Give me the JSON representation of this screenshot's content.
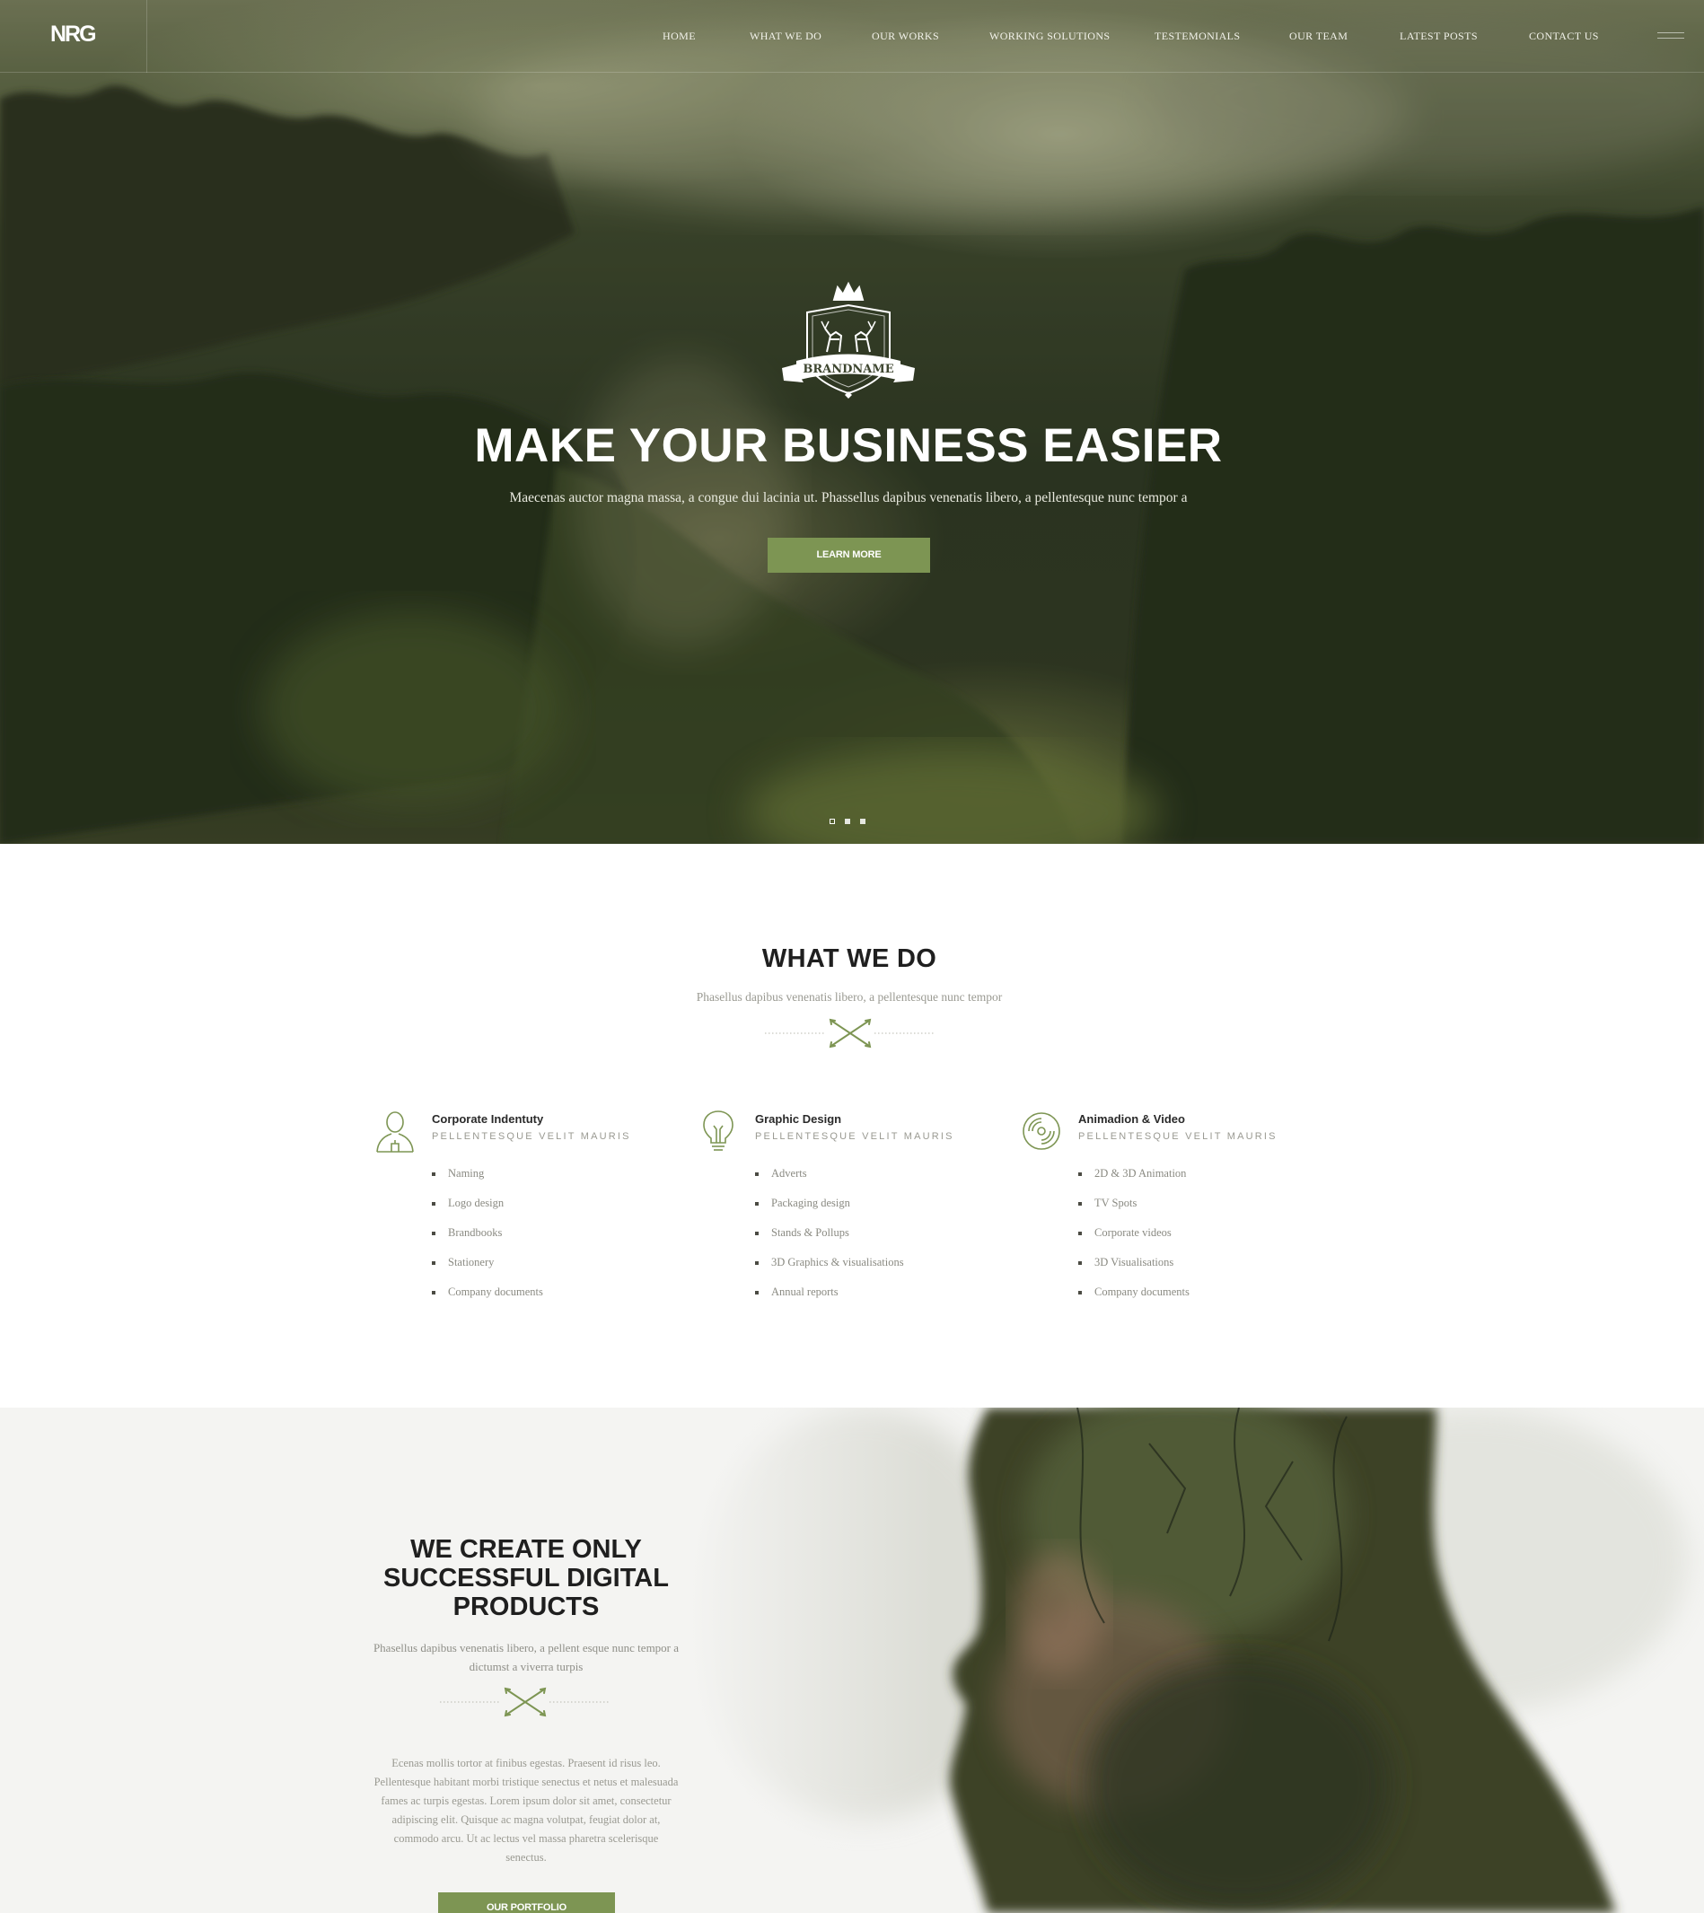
{
  "header": {
    "logo": "NRG",
    "nav": [
      "HOME",
      "WHAT WE DO",
      "OUR WORKS",
      "WORKING SOLUTIONS",
      "TESTEMONIALS",
      "OUR TEAM",
      "LATEST POSTS",
      "CONTACT US"
    ]
  },
  "hero": {
    "emblem_text": "BRANDNAME",
    "title": "MAKE YOUR BUSINESS EASIER",
    "subtitle": "Maecenas auctor magna massa, a congue dui lacinia ut. Phassellus dapibus venenatis libero, a pellentesque nunc tempor a",
    "button": "LEARN MORE",
    "slides": 3,
    "active_slide": 1
  },
  "what_we_do": {
    "title": "WHAT WE DO",
    "subtitle": "Phasellus dapibus venenatis libero, a pellentesque nunc tempor",
    "services": [
      {
        "icon": "person-icon",
        "title": "Corporate Indentuty",
        "tagline": "PELLENTESQUE VELIT MAURIS",
        "items": [
          "Naming",
          "Logo design",
          "Brandbooks",
          "Stationery",
          "Company documents"
        ]
      },
      {
        "icon": "lightbulb-icon",
        "title": "Graphic Design",
        "tagline": "PELLENTESQUE VELIT MAURIS",
        "items": [
          "Adverts",
          "Packaging design",
          "Stands & Pollups",
          "3D Graphics & visualisations",
          "Annual reports"
        ]
      },
      {
        "icon": "vinyl-disc-icon",
        "title": "Animadion & Video",
        "tagline": "PELLENTESQUE VELIT MAURIS",
        "items": [
          "2D & 3D Animation",
          "TV Spots",
          "Corporate videos",
          "3D Visualisations",
          "Company documents"
        ]
      }
    ]
  },
  "create": {
    "title_lines": [
      "WE CREATE ONLY",
      "SUCCESSFUL DIGITAL",
      "PRODUCTS"
    ],
    "subtitle": "Phasellus dapibus venenatis libero, a pellent esque nunc tempor a dictumst a viverra turpis",
    "body": "Ecenas mollis tortor at finibus egestas. Praesent id risus leo. Pellentesque habitant morbi tristique senectus et netus et malesuada fames ac turpis egestas. Lorem ipsum dolor sit amet, consectetur adipiscing elit. Quisque ac magna volutpat, feugiat dolor at, commodo arcu. Ut ac lectus vel massa pharetra scelerisque senectus.",
    "button": "OUR PORTFOLIO"
  },
  "colors": {
    "accent": "#7d9553",
    "heading": "#1f1f1f",
    "muted_text": "#9a9a92",
    "section_bg": "#f4f4f2"
  }
}
